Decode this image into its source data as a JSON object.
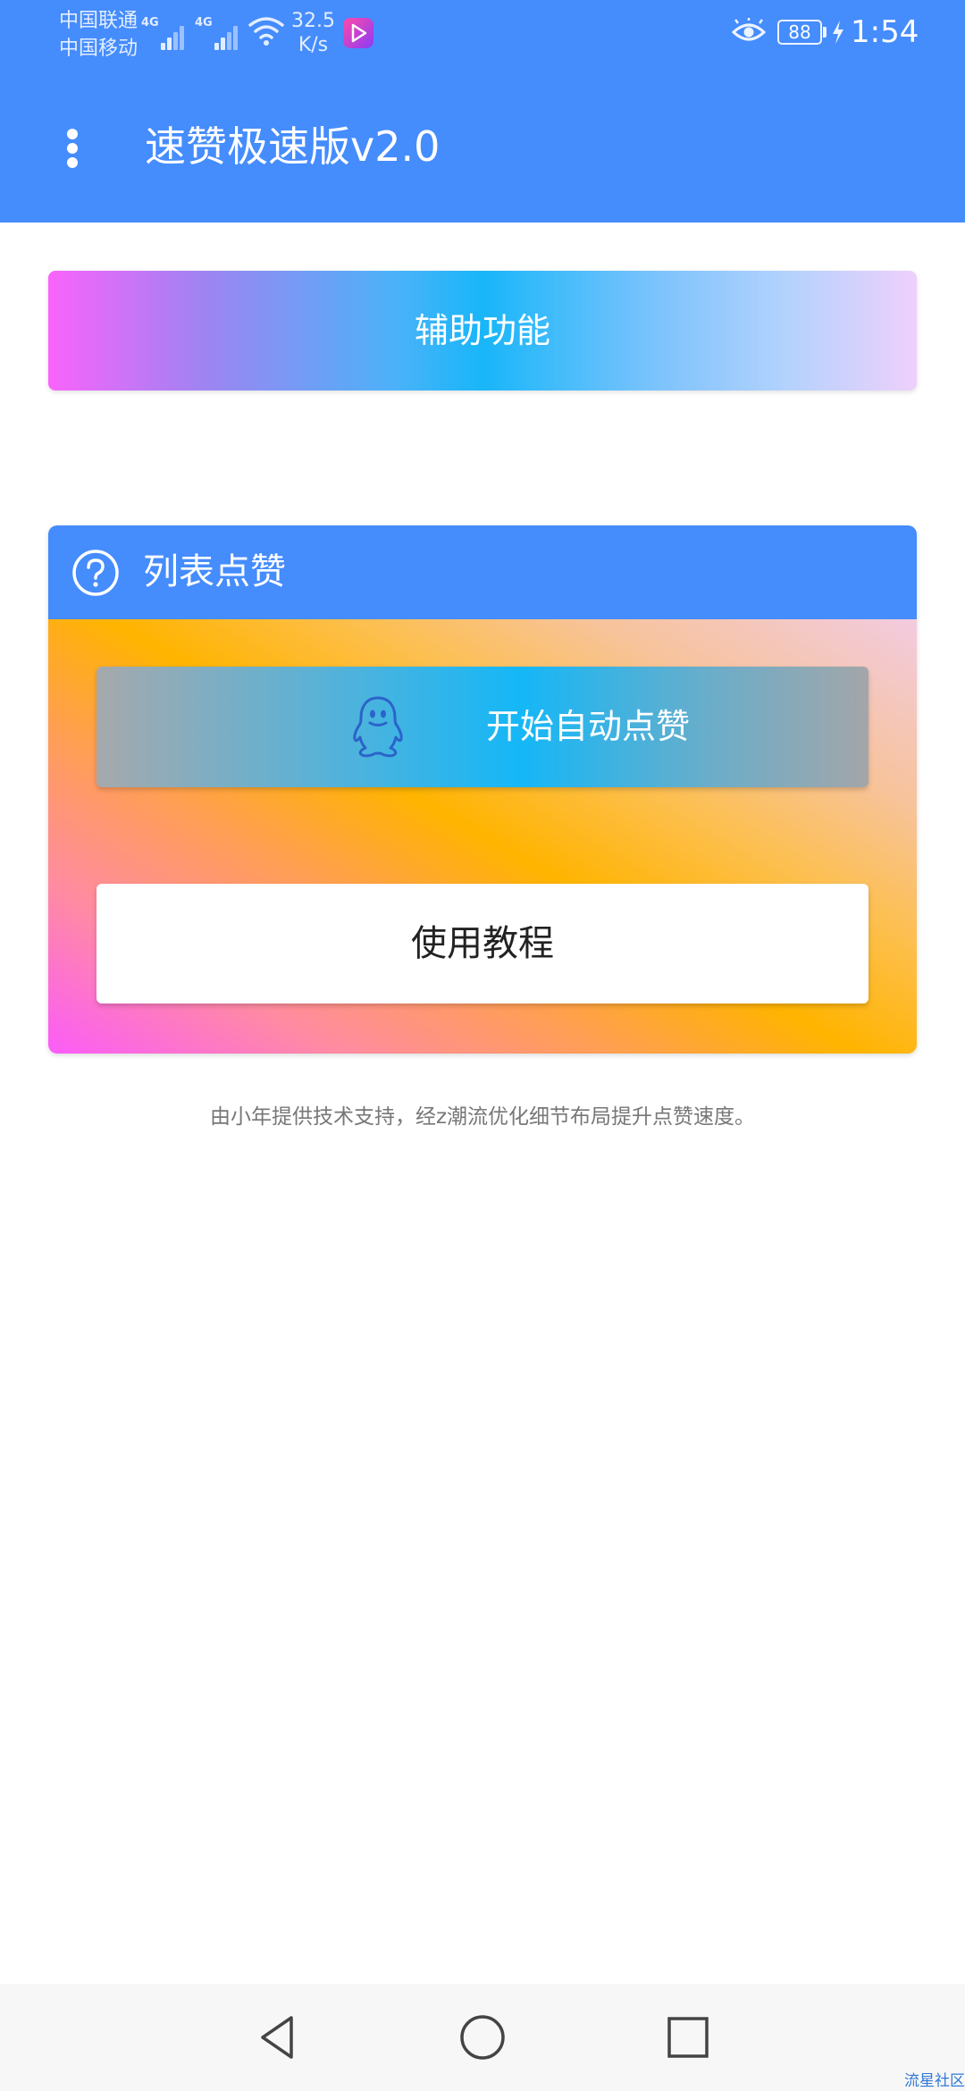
{
  "status_bar": {
    "carrier_1": "中国联通",
    "carrier_2": "中国移动",
    "network_1": "4G",
    "network_2": "4G",
    "speed_value": "32.5",
    "speed_unit": "K/s",
    "battery": "88",
    "time": "1:54",
    "icons": [
      "signal-icon",
      "wifi-icon",
      "video-app-icon",
      "eye-comfort-icon",
      "battery-icon",
      "charging-bolt-icon"
    ]
  },
  "toolbar": {
    "title": "速赞极速版v2.0",
    "menu_icon": "overflow-menu-icon"
  },
  "accessibility": {
    "label": "辅助功能"
  },
  "card": {
    "title": "列表点赞",
    "help_icon": "question-mark-icon",
    "start_button": {
      "label": "开始自动点赞",
      "icon": "qq-penguin-icon"
    },
    "tutorial_button": {
      "label": "使用教程"
    }
  },
  "footer": {
    "note": "由小年提供技术支持，经z潮流优化细节布局提升点赞速度。"
  },
  "navigation": {
    "back_icon": "back-triangle-icon",
    "home_icon": "home-circle-icon",
    "recents_icon": "recents-square-icon"
  },
  "watermark": "流星社区",
  "colors": {
    "primary": "#458cfd",
    "background": "#ffffff",
    "nav_bar": "#f7f7f7"
  }
}
